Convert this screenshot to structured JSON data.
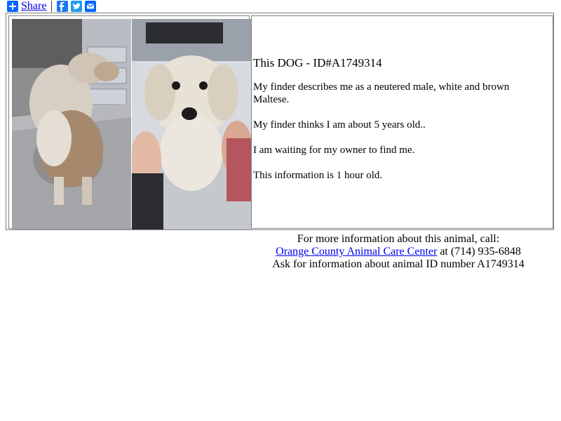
{
  "share_bar": {
    "share_label": "Share",
    "icons": [
      "plus-icon",
      "facebook-icon",
      "twitter-icon",
      "email-icon"
    ],
    "colors": {
      "addthis": "#0166ff",
      "facebook": "#1877f2",
      "twitter": "#1d9bf0"
    }
  },
  "animal": {
    "title_prefix": "This DOG - ",
    "title_id": "ID#A1749314",
    "description": "My finder describes me as a neutered male, white and brown Maltese.",
    "age": "My finder thinks I am about 5 years old..",
    "status": "I am waiting for my owner to find me.",
    "freshness": "This information is 1 hour old."
  },
  "footer": {
    "line1": "For more information about this animal, call:",
    "center_link": "Orange County Animal Care Center",
    "phone": " at (714) 935-6848",
    "line3": "Ask for information about animal ID number A1749314"
  }
}
